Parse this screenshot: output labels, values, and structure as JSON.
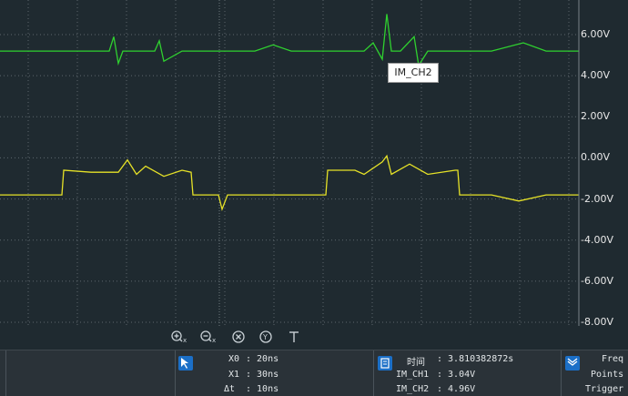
{
  "chart_data": {
    "type": "line",
    "y_tick_labels": [
      "6.00V",
      "4.00V",
      "2.00V",
      "0.00V",
      "-2.00V",
      "-4.00V",
      "-6.00V",
      "-8.00V"
    ],
    "ylim": [
      -8,
      7.5
    ],
    "grid": true,
    "series": [
      {
        "name": "IM_CH2",
        "color": "#2fd12f",
        "x": [
          0,
          40,
          80,
          120,
          125,
          130,
          135,
          170,
          175,
          180,
          200,
          240,
          280,
          300,
          320,
          360,
          400,
          410,
          420,
          425,
          430,
          440,
          455,
          460,
          470,
          500,
          540,
          575,
          600,
          636
        ],
        "values": [
          5.2,
          5.2,
          5.2,
          5.2,
          5.9,
          4.6,
          5.2,
          5.2,
          5.7,
          4.7,
          5.2,
          5.2,
          5.2,
          5.5,
          5.2,
          5.2,
          5.2,
          5.6,
          4.8,
          7.0,
          5.2,
          5.2,
          5.9,
          4.5,
          5.2,
          5.2,
          5.2,
          5.6,
          5.2,
          5.2
        ]
      },
      {
        "name": "IM_CH1",
        "color": "#e6e227",
        "x": [
          0,
          60,
          68,
          70,
          100,
          130,
          140,
          150,
          160,
          180,
          200,
          210,
          212,
          240,
          244,
          250,
          300,
          356,
          358,
          360,
          390,
          400,
          420,
          425,
          430,
          450,
          470,
          500,
          503,
          505,
          540,
          570,
          600,
          636
        ],
        "values": [
          -1.8,
          -1.8,
          -1.8,
          -0.6,
          -0.7,
          -0.7,
          -0.1,
          -0.8,
          -0.4,
          -0.9,
          -0.6,
          -0.7,
          -1.8,
          -1.8,
          -2.5,
          -1.8,
          -1.8,
          -1.8,
          -1.8,
          -0.6,
          -0.6,
          -0.8,
          -0.2,
          0.1,
          -0.8,
          -0.3,
          -0.8,
          -0.6,
          -0.6,
          -1.8,
          -1.8,
          -2.1,
          -1.8,
          -1.8
        ]
      }
    ]
  },
  "tooltip": {
    "text": "IM_CH2"
  },
  "toolbar": {
    "items": [
      "zoom-in-x",
      "zoom-out-x",
      "zoom-reset",
      "zoom-fit",
      "trigger"
    ]
  },
  "cursor_panel": {
    "x0_label": "X0",
    "x0_value": ": 20ns",
    "x1_label": "X1",
    "x1_value": ": 30ns",
    "dt_label": "Δt",
    "dt_value": ": 10ns"
  },
  "measure_panel": {
    "time_label": "时间",
    "time_value": ": 3.810382872s",
    "ch1_label": "IM_CH1",
    "ch1_value": ": 3.04V",
    "ch2_label": "IM_CH2",
    "ch2_value": ": 4.96V"
  },
  "freq_panel": {
    "freq_label": "Freq",
    "points_label": "Points",
    "trigger_label": "Trigger"
  }
}
